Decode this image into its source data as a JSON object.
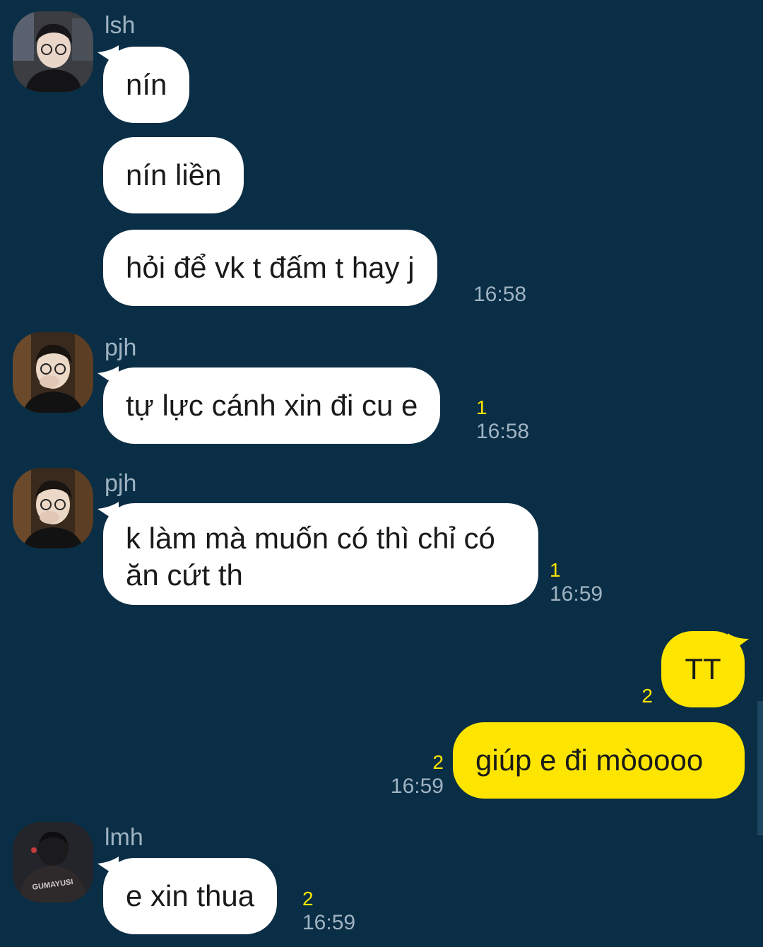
{
  "messages": [
    {
      "sender": "lsh",
      "text": "nín"
    },
    {
      "text": "nín liền"
    },
    {
      "text": "hỏi để vk t đấm t hay j",
      "time": "16:58"
    },
    {
      "sender": "pjh",
      "text": "tự lực cánh xin đi cu e",
      "count": "1",
      "time": "16:58"
    },
    {
      "sender": "pjh",
      "text": "k làm mà muốn có thì chỉ có ăn cứt th",
      "count": "1",
      "time": "16:59"
    },
    {
      "mine": true,
      "text": "TT",
      "count": "2"
    },
    {
      "mine": true,
      "text": "giúp e đi mòoooo",
      "count": "2",
      "time": "16:59"
    },
    {
      "sender": "lmh",
      "text": "e xin thua",
      "count": "2",
      "time": "16:59"
    }
  ],
  "avatar_shirt_text": "GUMAYUSI",
  "colors": {
    "background": "#0a2e45",
    "incoming_bubble": "#ffffff",
    "outgoing_bubble": "#fee500",
    "unread_count": "#fee500",
    "meta_text": "#9fb3c2"
  }
}
